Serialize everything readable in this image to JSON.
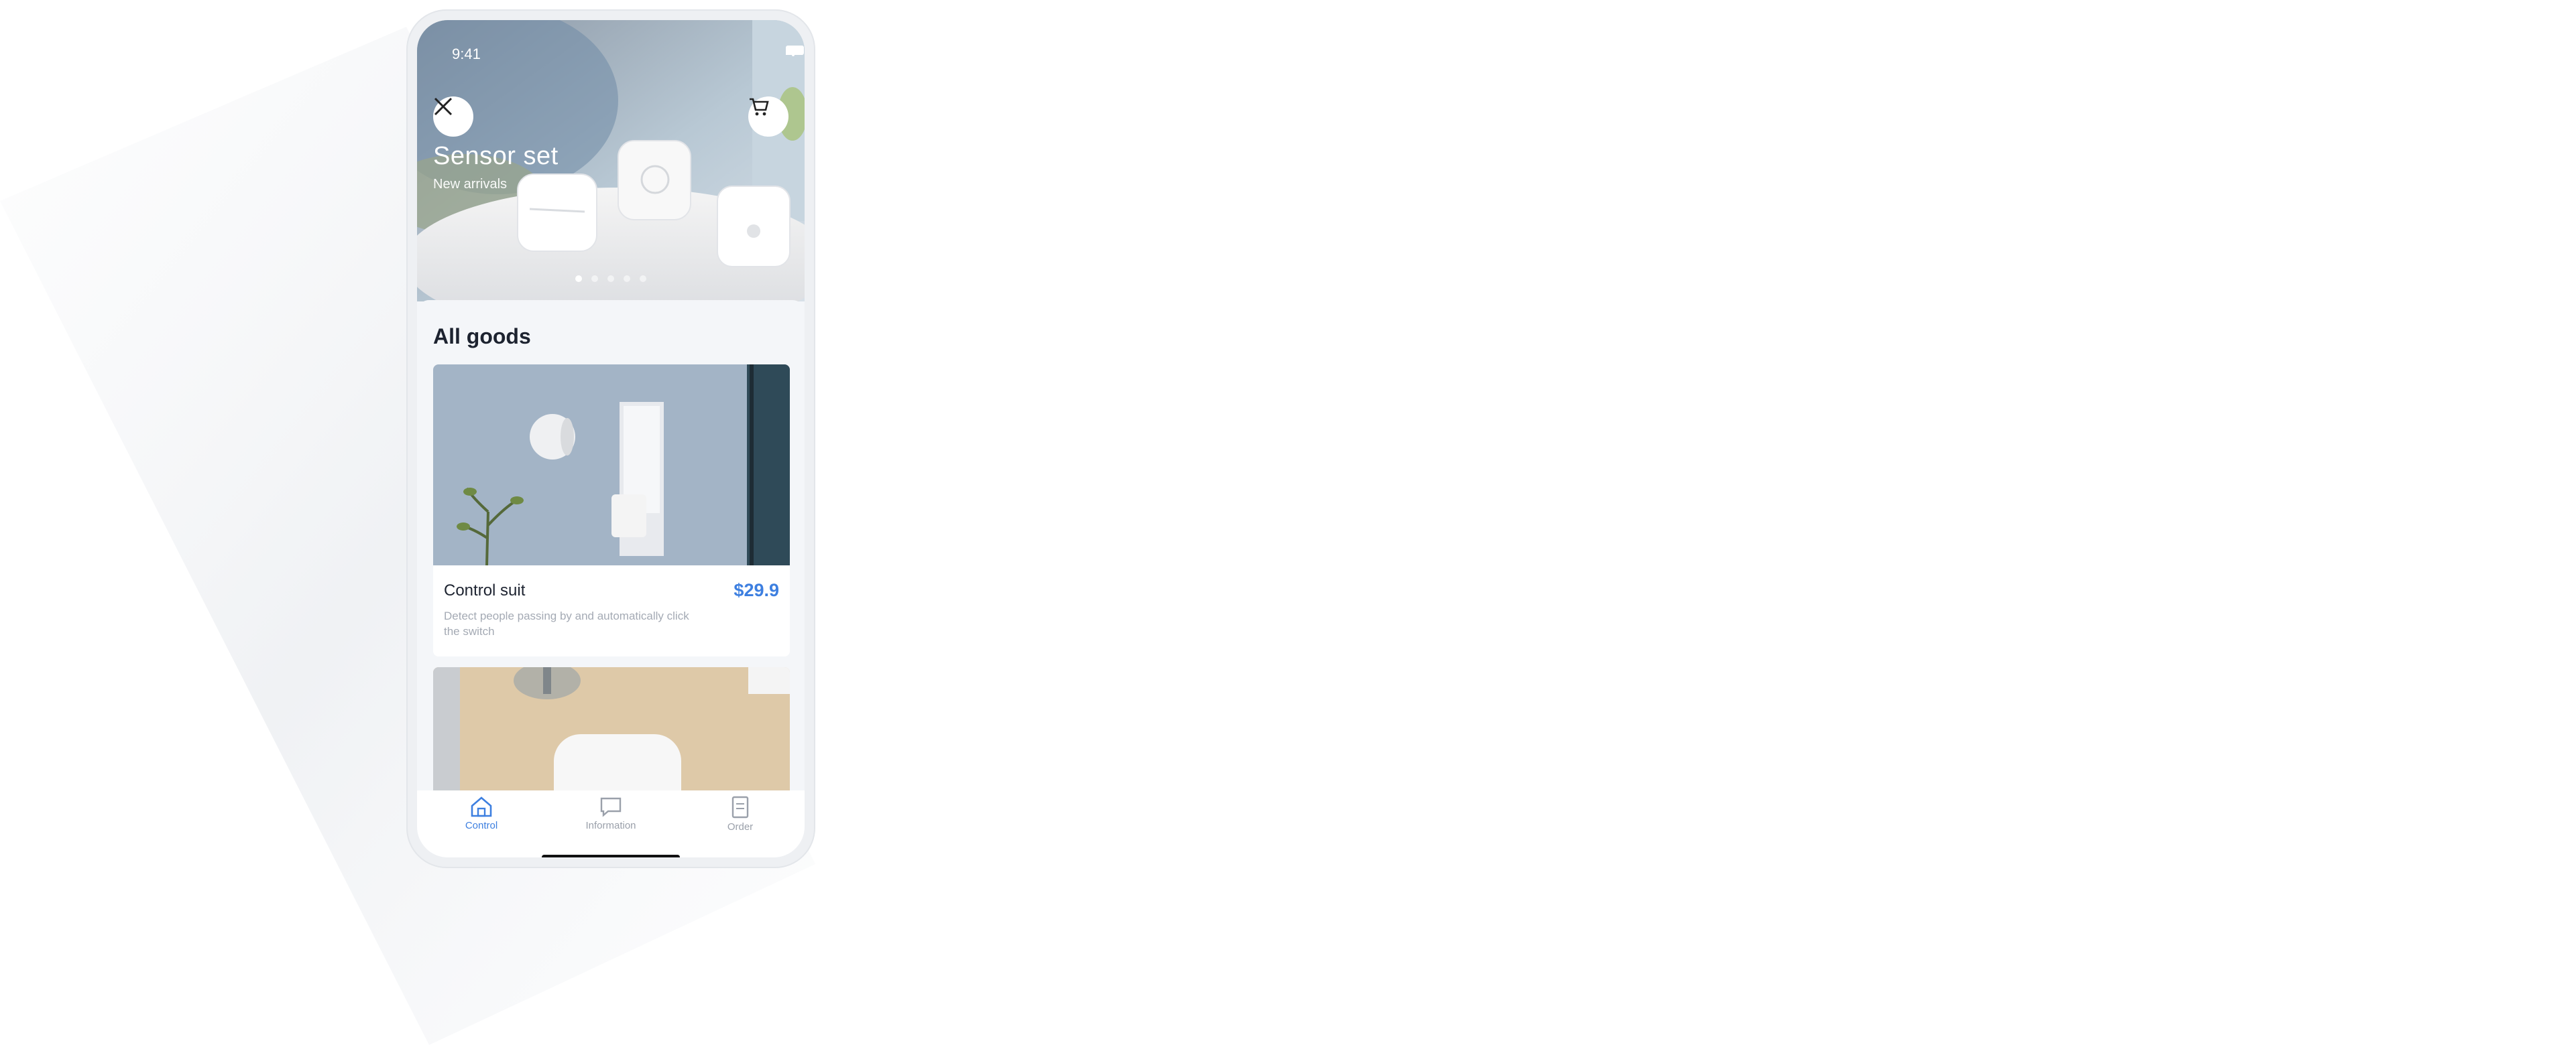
{
  "status_bar": {
    "time": "9:41",
    "icons": [
      "signal-icon",
      "wifi-icon",
      "battery-icon"
    ]
  },
  "hero": {
    "close_icon": "close-icon",
    "cart_icon": "cart-icon",
    "title": "Sensor set",
    "subtitle": "New arrivals",
    "carousel": {
      "count": 5,
      "active_index": 0
    }
  },
  "main": {
    "section_title": "All goods",
    "products": [
      {
        "name": "Control suit",
        "price": "$29.9",
        "description": "Detect people passing by and automatically click the switch"
      },
      {
        "name": "",
        "price": "",
        "description": ""
      }
    ]
  },
  "tabbar": {
    "tabs": [
      {
        "label": "Control",
        "icon": "home-icon",
        "active": true
      },
      {
        "label": "Information",
        "icon": "chat-icon",
        "active": false
      },
      {
        "label": "Order",
        "icon": "document-icon",
        "active": false
      }
    ]
  },
  "colors": {
    "accent": "#3d7fe0",
    "background": "#f4f6f9",
    "text": "#1d2330",
    "muted": "#a4aab4"
  }
}
